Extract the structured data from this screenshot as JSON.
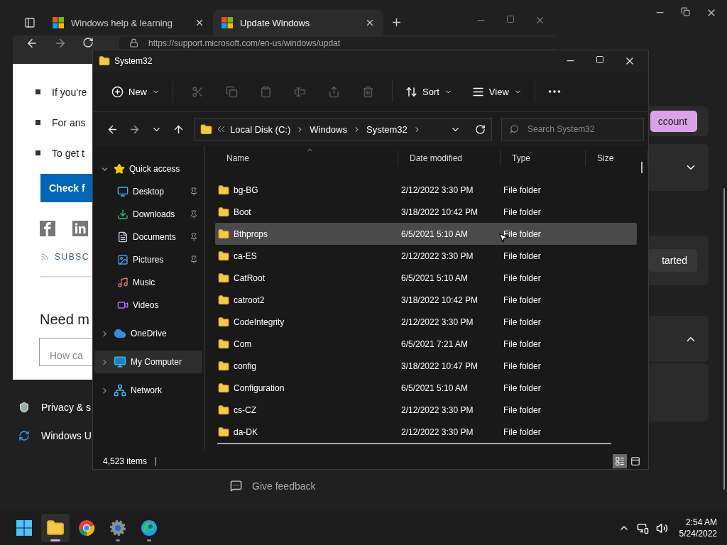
{
  "settings": {
    "nav": [
      {
        "label": "Privacy & s",
        "kind": "shield"
      },
      {
        "label": "Windows U",
        "kind": "update"
      }
    ],
    "account_button": "ccount",
    "start_button": "tarted",
    "feedback": "Give feedback"
  },
  "browser": {
    "tabs": [
      {
        "label": "Windows help & learning",
        "selected": false
      },
      {
        "label": "Update Windows",
        "selected": true
      }
    ],
    "url": "https://support.microsoft.com/en-us/windows/updat",
    "bullets": [
      "If you're",
      "For ans",
      "To get t"
    ],
    "check_button": "Check f",
    "subscribe": "SUBSC",
    "heading": "Need m",
    "search_placeholder": "How ca"
  },
  "explorer": {
    "title": "System32",
    "toolbar": {
      "new": "New",
      "sort": "Sort",
      "view": "View"
    },
    "breadcrumb": [
      "Local Disk (C:)",
      "Windows",
      "System32"
    ],
    "search_placeholder": "Search System32",
    "sidebar": [
      {
        "label": "Quick access",
        "kind": "star",
        "expanded": true,
        "selected": false,
        "children": [
          {
            "label": "Desktop",
            "kind": "desktop",
            "pinned": true,
            "selected": false
          },
          {
            "label": "Downloads",
            "kind": "downloads",
            "pinned": true,
            "selected": false
          },
          {
            "label": "Documents",
            "kind": "documents",
            "pinned": true,
            "selected": false
          },
          {
            "label": "Pictures",
            "kind": "pictures",
            "pinned": true,
            "selected": false
          },
          {
            "label": "Music",
            "kind": "music",
            "pinned": false,
            "selected": false
          },
          {
            "label": "Videos",
            "kind": "videos",
            "pinned": false,
            "selected": false
          }
        ]
      },
      {
        "label": "OneDrive",
        "kind": "cloud",
        "expanded": false,
        "selected": false
      },
      {
        "label": "My Computer",
        "kind": "computer",
        "expanded": false,
        "selected": true
      },
      {
        "label": "Network",
        "kind": "network",
        "expanded": false,
        "selected": false
      }
    ],
    "columns": [
      "Name",
      "Date modified",
      "Type",
      "Size"
    ],
    "rows": [
      {
        "name": "bg-BG",
        "date": "2/12/2022 3:30 PM",
        "type": "File folder",
        "selected": false
      },
      {
        "name": "Boot",
        "date": "3/18/2022 10:42 PM",
        "type": "File folder",
        "selected": false
      },
      {
        "name": "Bthprops",
        "date": "6/5/2021 5:10 AM",
        "type": "File folder",
        "selected": true
      },
      {
        "name": "ca-ES",
        "date": "2/12/2022 3:30 PM",
        "type": "File folder",
        "selected": false
      },
      {
        "name": "CatRoot",
        "date": "6/5/2021 5:10 AM",
        "type": "File folder",
        "selected": false
      },
      {
        "name": "catroot2",
        "date": "3/18/2022 10:42 PM",
        "type": "File folder",
        "selected": false
      },
      {
        "name": "CodeIntegrity",
        "date": "2/12/2022 3:30 PM",
        "type": "File folder",
        "selected": false
      },
      {
        "name": "Com",
        "date": "6/5/2021 7:21 AM",
        "type": "File folder",
        "selected": false
      },
      {
        "name": "config",
        "date": "3/18/2022 10:47 PM",
        "type": "File folder",
        "selected": false
      },
      {
        "name": "Configuration",
        "date": "6/5/2021 5:10 AM",
        "type": "File folder",
        "selected": false
      },
      {
        "name": "cs-CZ",
        "date": "2/12/2022 3:30 PM",
        "type": "File folder",
        "selected": false
      },
      {
        "name": "da-DK",
        "date": "2/12/2022 3:30 PM",
        "type": "File folder",
        "selected": false
      }
    ],
    "status": "4,523 items",
    "views": [
      {
        "kind": "details",
        "selected": true
      },
      {
        "kind": "tiles",
        "selected": false
      }
    ]
  },
  "taskbar": {
    "apps": [
      {
        "kind": "files",
        "running": true,
        "active": true
      },
      {
        "kind": "chrome",
        "running": false,
        "active": false
      },
      {
        "kind": "settings",
        "running": true,
        "active": false
      },
      {
        "kind": "edge",
        "running": true,
        "active": false
      }
    ],
    "time": "2:54 AM",
    "date": "5/24/2022"
  }
}
